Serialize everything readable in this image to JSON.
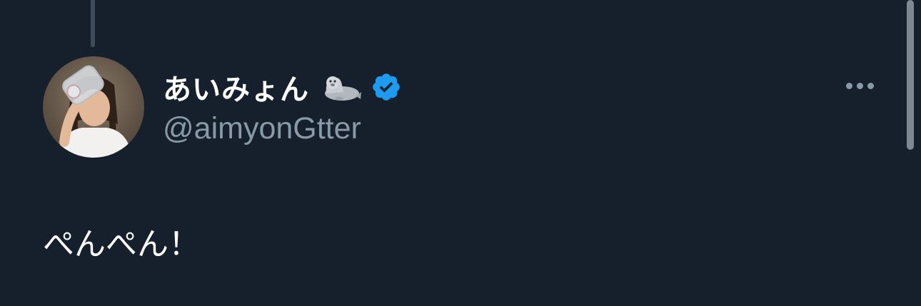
{
  "tweet": {
    "author": {
      "display_name": "あいみょん",
      "handle": "@aimyonGtter",
      "name_emoji": "seal-icon",
      "verified": true,
      "verified_color": "#1d9bf0"
    },
    "text": "ぺんぺん！",
    "more_icon": "more-horizontal-icon"
  },
  "theme": {
    "background": "#16202c",
    "text_primary": "#ffffff",
    "text_secondary": "#8899a8"
  }
}
